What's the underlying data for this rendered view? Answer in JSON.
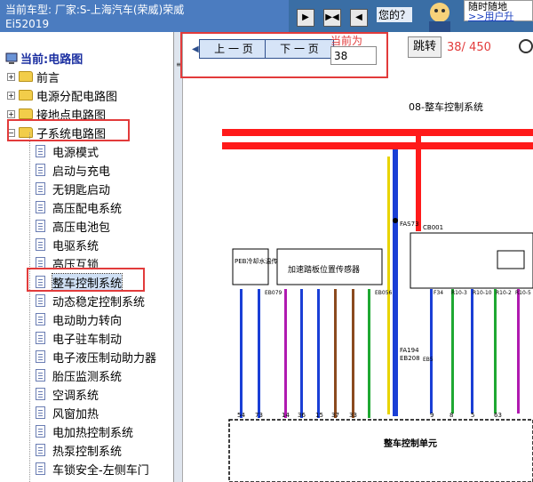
{
  "header": {
    "vehicle_line1": "当前车型:  厂家:S-上海汽车(荣威)荣威",
    "vehicle_line2": "Ei52019",
    "prompt": "您的？",
    "ad_line1": "随时随地",
    "ad_link": ">>用户升"
  },
  "sidebar": {
    "current_label": "当前:电路图",
    "folders": [
      {
        "label": "前言"
      },
      {
        "label": "电源分配电路图"
      },
      {
        "label": "接地点电路图"
      },
      {
        "label": "子系统电路图"
      }
    ],
    "items": [
      {
        "label": "电源模式"
      },
      {
        "label": "启动与充电"
      },
      {
        "label": "无钥匙启动"
      },
      {
        "label": "高压配电系统"
      },
      {
        "label": "高压电池包"
      },
      {
        "label": "电驱系统"
      },
      {
        "label": "高压互锁"
      },
      {
        "label": "整车控制系统"
      },
      {
        "label": "动态稳定控制系统"
      },
      {
        "label": "电动助力转向"
      },
      {
        "label": "电子驻车制动"
      },
      {
        "label": "电子液压制动助力器"
      },
      {
        "label": "胎压监测系统"
      },
      {
        "label": "空调系统"
      },
      {
        "label": "风窗加热"
      },
      {
        "label": "电加热控制系统"
      },
      {
        "label": "热泵控制系统"
      },
      {
        "label": "车锁安全-左侧车门"
      }
    ]
  },
  "pager": {
    "prev_label": "上 一 页",
    "next_label": "下 一 页",
    "current_page_label": "当前为",
    "current_page_value": "38",
    "jump_label": "跳转",
    "counter": "38/ 450"
  },
  "diagram": {
    "title": "08-整车控制系统",
    "labels": {
      "peb_sensor": "PEB冷却水温传感器",
      "pedal_sensor": "加速踏板位置传感器",
      "vcu": "整车控制单元",
      "fas73": "FAS73",
      "cb001": "CB001",
      "fa194": "FA194",
      "eb208": "EB208",
      "eb079": "EB079",
      "eb056": "EB056",
      "eb5": "EB5",
      "f34": "F34",
      "r103": "R10-3",
      "r1010": "R10-10",
      "r102": "R10-2",
      "r105": "R10-5",
      "pin54": "54",
      "pin73": "73",
      "pin14": "14",
      "pin36": "36",
      "pin15": "15",
      "pin37": "37",
      "pin33": "33",
      "pin9": "9",
      "pin8": "8",
      "pin5": "5",
      "pin63": "63"
    }
  },
  "colors": {
    "header_bg": "#3a6ea5",
    "highlight": "#e23b3b",
    "wire_red": "#ff1a1a",
    "wire_blue": "#1a3fd6",
    "wire_green": "#1fa832",
    "wire_brown": "#8b4a1e",
    "wire_yellow": "#e8d400",
    "wire_purple": "#b01ab0"
  }
}
